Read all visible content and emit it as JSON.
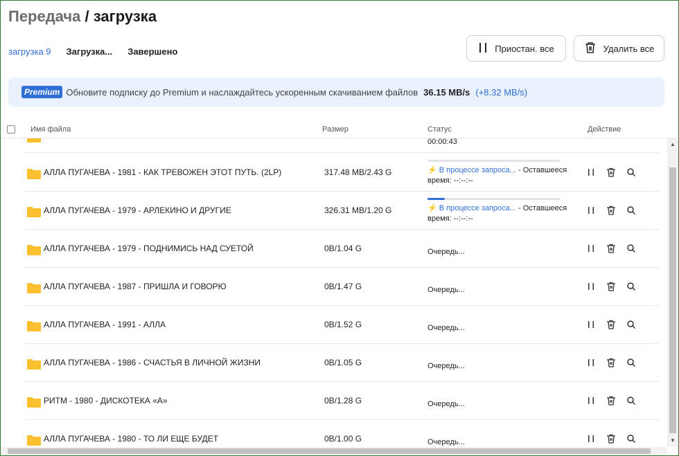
{
  "header": {
    "title_part1": "Передача",
    "title_sep": " / ",
    "title_part2": "загрузка"
  },
  "tabs": [
    {
      "label": "загрузка 9",
      "active": true
    },
    {
      "label": "Загрузка...",
      "active": false
    },
    {
      "label": "Завершено",
      "active": false
    }
  ],
  "toolbar": {
    "pause_all_label": "Приостан. все",
    "delete_all_label": "Удалить все"
  },
  "banner": {
    "badge": "Premium",
    "text": "Обновите подписку до Premium и наслаждайтесь ускоренным скачиванием файлов",
    "speed": "36.15 MB/s",
    "boost": "(+8.32 MB/s)"
  },
  "table": {
    "columns": {
      "name": "Имя файла",
      "size": "Размер",
      "status": "Статус",
      "action": "Действие"
    },
    "partial_row_status": "00:00:43",
    "rows": [
      {
        "name": "АЛЛА ПУГАЧЕВА - 1981 - КАК ТРЕВОЖЕН ЭТОТ ПУТЬ. (2LP)",
        "size": "317.48 MB/2.43 G",
        "state": "requesting",
        "progress": 0.0,
        "status_link": "В процессе запроса...",
        "status_rest": " - Оставшееся",
        "status_time": "время: --:--:--"
      },
      {
        "name": "АЛЛА ПУГАЧЕВА - 1979 - АРЛЕКИНО И ДРУГИЕ",
        "size": "326.31 MB/1.20 G",
        "state": "requesting",
        "progress": 0.13,
        "status_link": "В процессе запроса...",
        "status_rest": " - Оставшееся",
        "status_time": "время: --:--:--"
      },
      {
        "name": "АЛЛА ПУГАЧЕВА - 1979 - ПОДНИМИСЬ НАД СУЕТОЙ",
        "size": "0B/1.04 G",
        "state": "queued",
        "status": "Очередь..."
      },
      {
        "name": "АЛЛА ПУГАЧЕВА - 1987 - ПРИШЛА И ГОВОРЮ",
        "size": "0B/1.47 G",
        "state": "queued",
        "status": "Очередь..."
      },
      {
        "name": "АЛЛА ПУГАЧЕВА - 1991 - АЛЛА",
        "size": "0B/1.52 G",
        "state": "queued",
        "status": "Очередь..."
      },
      {
        "name": "АЛЛА ПУГАЧЕВА - 1986 - СЧАСТЬЯ В ЛИЧНОЙ ЖИЗНИ",
        "size": "0B/1.05 G",
        "state": "queued",
        "status": "Очередь..."
      },
      {
        "name": "РИТМ - 1980 - ДИСКОТЕКА «А»",
        "size": "0B/1.28 G",
        "state": "queued",
        "status": "Очередь..."
      },
      {
        "name": "АЛЛА ПУГАЧЕВА - 1980 - ТО ЛИ ЕЩЕ БУДЕТ",
        "size": "0B/1.00 G",
        "state": "queued",
        "status": "Очередь..."
      }
    ]
  },
  "colors": {
    "accent": "#2f6fd6",
    "folder": "#fbc02d"
  },
  "icons": {
    "row_actions": [
      "pause-icon",
      "trash-icon",
      "search-icon"
    ],
    "file": "folder-icon"
  }
}
